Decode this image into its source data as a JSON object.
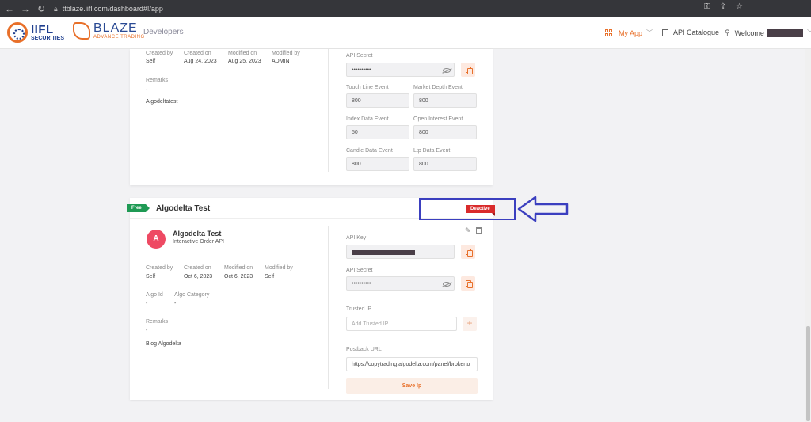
{
  "browser": {
    "url": "ttblaze.iifl.com/dashboard#!/app"
  },
  "header": {
    "iifl_big": "IIFL",
    "iifl_small": "SECURITIES",
    "blaze_big": "BLAZE",
    "blaze_small": "ADVANCE TRADING",
    "section": "Developers",
    "my_app": "My App",
    "api_catalogue": "API Catalogue",
    "welcome": "Welcome"
  },
  "card1": {
    "meta_labels": [
      "Created by",
      "Created on",
      "Modified on",
      "Modified by"
    ],
    "meta_values": [
      "Self",
      "Aug 24, 2023",
      "Aug 25, 2023",
      "ADMIN"
    ],
    "remarks_label": "Remarks",
    "remarks_value": "-",
    "description": "Algodeltatest",
    "api_secret_label": "API Secret",
    "api_secret_value": "••••••••••",
    "events": [
      {
        "label": "Touch Line Event",
        "value": "800"
      },
      {
        "label": "Market Depth Event",
        "value": "800"
      },
      {
        "label": "Index Data Event",
        "value": "50"
      },
      {
        "label": "Open Interest Event",
        "value": "800"
      },
      {
        "label": "Candle Data Event",
        "value": "800"
      },
      {
        "label": "Ltp Data Event",
        "value": "800"
      }
    ]
  },
  "card2": {
    "tag": "Free",
    "title": "Algodelta Test",
    "status": "Deactive",
    "avatar_letter": "A",
    "app_name": "Algodelta Test",
    "app_type": "Interactive Order API",
    "meta_labels": [
      "Created by",
      "Created on",
      "Modified on",
      "Modified by"
    ],
    "meta_values": [
      "Self",
      "Oct 6, 2023",
      "Oct 6, 2023",
      "Self"
    ],
    "algo_id_label": "Algo Id",
    "algo_id_value": "-",
    "algo_cat_label": "Algo Category",
    "algo_cat_value": "-",
    "remarks_label": "Remarks",
    "remarks_value": "-",
    "description": "Blog Algodelta",
    "api_key_label": "API Key",
    "api_secret_label": "API Secret",
    "api_secret_value": "••••••••••",
    "trusted_ip_label": "Trusted IP",
    "trusted_ip_placeholder": "Add Trusted IP",
    "postback_label": "Postback URL",
    "postback_value": "https://copytrading.algodelta.com/panel/brokerto",
    "save_ip": "Save Ip"
  },
  "colors": {
    "accent": "#e8702a",
    "free": "#1f9a54",
    "deactive": "#d92b2b",
    "annotation": "#3b3fbf",
    "avatar": "#ee4a63"
  }
}
